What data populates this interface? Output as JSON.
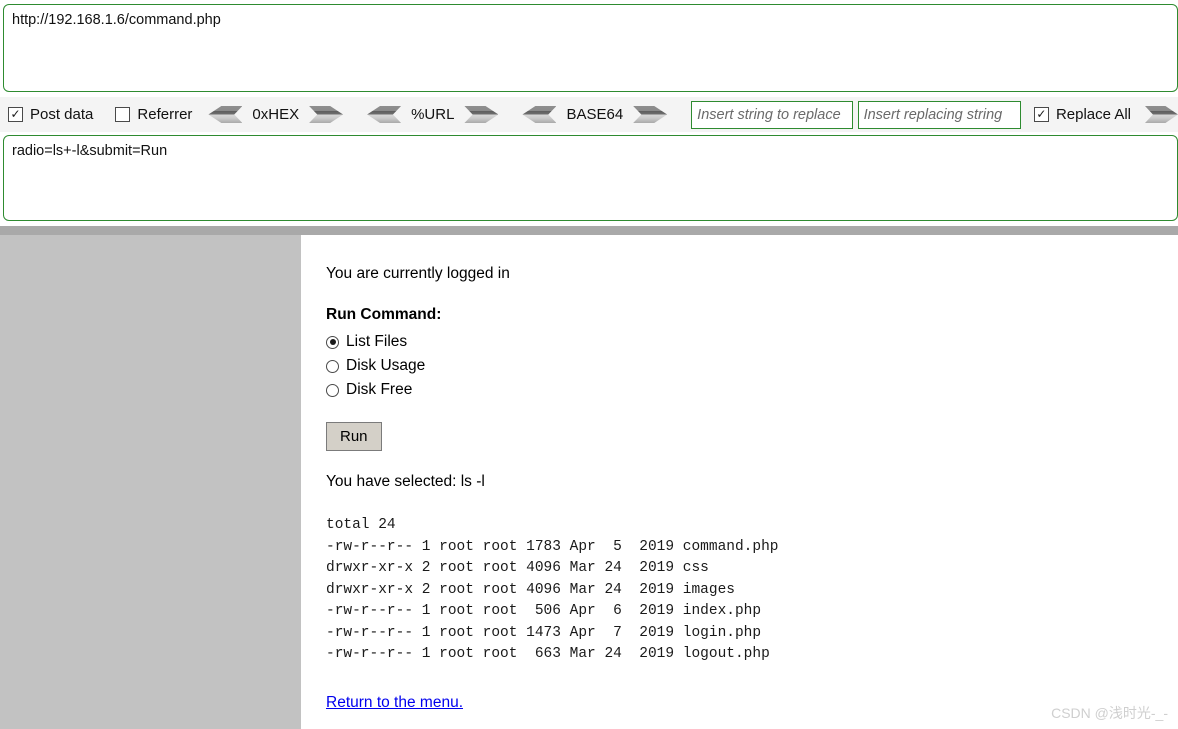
{
  "tool_panel": {
    "url_value": "http://192.168.1.6/command.php",
    "post_data_value": "radio=ls+-l&submit=Run",
    "options": {
      "post_data_label": "Post data",
      "post_data_checked": true,
      "referrer_label": "Referrer",
      "referrer_checked": false,
      "hex_label": "0xHEX",
      "url_encode_label": "%URL",
      "base64_label": "BASE64",
      "replace_all_label": "Replace All",
      "replace_all_checked": true
    },
    "replace_from_placeholder": "Insert string to replace",
    "replace_to_placeholder": "Insert replacing string"
  },
  "page": {
    "status_text": "You are currently logged in",
    "form_heading": "Run Command:",
    "radios": [
      {
        "label": "List Files",
        "selected": true
      },
      {
        "label": "Disk Usage",
        "selected": false
      },
      {
        "label": "Disk Free",
        "selected": false
      }
    ],
    "submit_label": "Run",
    "selected_text": "You have selected: ls -l",
    "command_output": "total 24\n-rw-r--r-- 1 root root 1783 Apr  5  2019 command.php\ndrwxr-xr-x 2 root root 4096 Mar 24  2019 css\ndrwxr-xr-x 2 root root 4096 Mar 24  2019 images\n-rw-r--r-- 1 root root  506 Apr  6  2019 index.php\n-rw-r--r-- 1 root root 1473 Apr  7  2019 login.php\n-rw-r--r-- 1 root root  663 Mar 24  2019 logout.php",
    "return_link_label": "Return to the menu.",
    "watermark": "CSDN @浅时光-_-"
  }
}
